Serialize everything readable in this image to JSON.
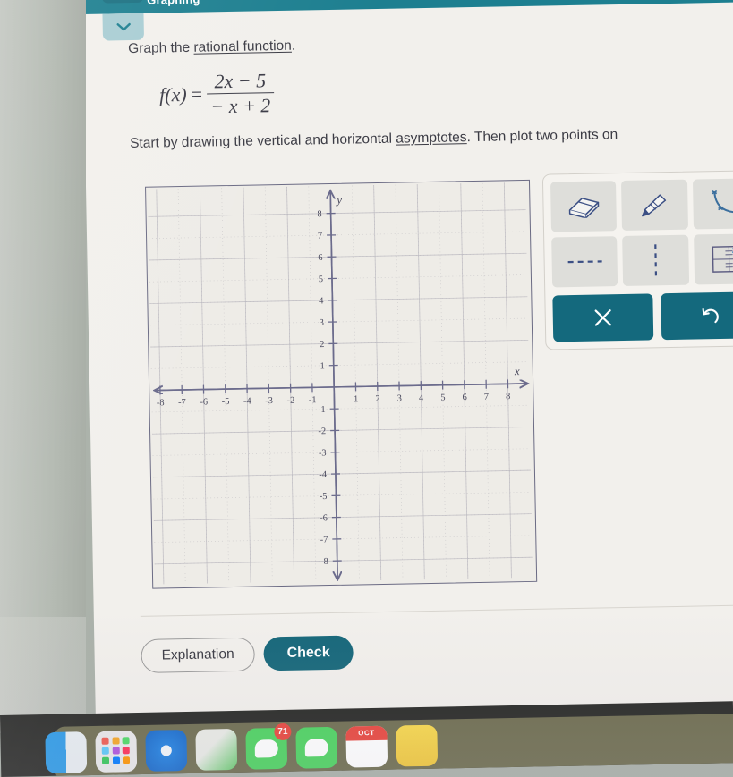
{
  "app": {
    "header_title": "Graphing",
    "collapse_icon": "chevron-down-icon"
  },
  "question": {
    "prompt_prefix": "Graph the ",
    "prompt_term": "rational function",
    "prompt_suffix": ".",
    "formula": {
      "fx": "f(x)",
      "equals": "=",
      "numerator": "2x − 5",
      "denominator": "− x + 2"
    },
    "instruction_prefix": "Start by drawing the vertical and horizontal ",
    "instruction_term": "asymptotes",
    "instruction_suffix": ". Then plot two points on"
  },
  "graph": {
    "x_label": "x",
    "y_label": "y",
    "x_ticks": [
      -8,
      -7,
      -6,
      -5,
      -4,
      -3,
      -2,
      -1,
      1,
      2,
      3,
      4,
      5,
      6,
      7,
      8
    ],
    "y_ticks": [
      8,
      7,
      6,
      5,
      4,
      3,
      2,
      1,
      -1,
      -2,
      -3,
      -4,
      -5,
      -6,
      -7,
      -8
    ],
    "xlim": [
      -8.6,
      8.6
    ],
    "ylim": [
      -8.6,
      8.6
    ],
    "grid": true,
    "axis_color": "#6b6b8c",
    "grid_color": "#c9c7c9"
  },
  "tools": [
    {
      "name": "eraser-tool",
      "label": "Eraser"
    },
    {
      "name": "pencil-tool",
      "label": "Pencil"
    },
    {
      "name": "curve-tool",
      "label": "Curve"
    },
    {
      "name": "horizontal-dashed-line-tool",
      "label": "Horizontal asymptote"
    },
    {
      "name": "vertical-dashed-line-tool",
      "label": "Vertical asymptote"
    },
    {
      "name": "graph-grid-tool",
      "label": "Graph a function"
    }
  ],
  "actions": {
    "clear_label": "✕",
    "undo_label": "↺",
    "button_color": "#14697d"
  },
  "footer": {
    "explanation_label": "Explanation",
    "check_label": "Check",
    "check_color": "#16677a"
  },
  "dock": {
    "items": [
      {
        "name": "finder-icon",
        "label": "Finder",
        "badge": ""
      },
      {
        "name": "launchpad-icon",
        "label": "Launchpad",
        "badge": ""
      },
      {
        "name": "safari-icon",
        "label": "Safari",
        "badge": ""
      },
      {
        "name": "maps-icon",
        "label": "Maps",
        "badge": ""
      },
      {
        "name": "facetime-icon",
        "label": "FaceTime",
        "badge": "71"
      },
      {
        "name": "messages-icon",
        "label": "Messages",
        "badge": ""
      },
      {
        "name": "calendar-icon",
        "label": "Calendar",
        "badge": "",
        "month": "OCT"
      },
      {
        "name": "notes-icon",
        "label": "Notes",
        "badge": ""
      }
    ]
  }
}
